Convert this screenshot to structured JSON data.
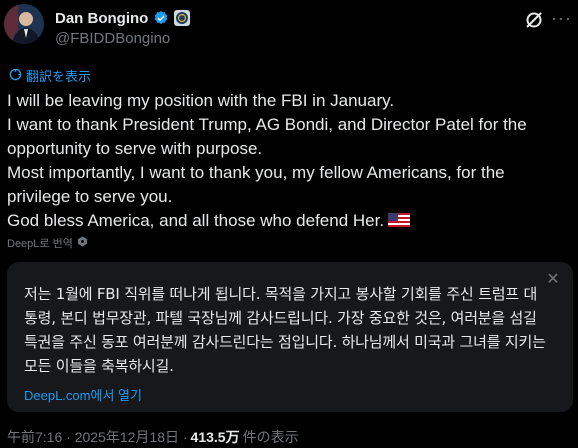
{
  "author": {
    "display_name": "Dan Bongino",
    "handle": "@FBIDDBongino"
  },
  "translate_link": "翻訳を表示",
  "tweet_lines": [
    "I will be leaving my position with the FBI in January.",
    "I want to thank President Trump, AG Bondi, and Director Patel for the",
    "opportunity to serve with purpose.",
    "Most importantly, I want to thank you, my fellow Americans, for the",
    "privilege to serve you.",
    "God bless America, and all those who defend Her."
  ],
  "deepl_credit": "DeepL로 번역",
  "translation": {
    "text": "저는 1월에 FBI 직위를 떠나게 됩니다. 목적을 가지고 봉사할 기회를 주신 트럼프 대통령, 본디 법무장관, 파텔 국장님께 감사드립니다. 가장 중요한 것은, 여러분을 섬길 특권을 주신 동포 여러분께 감사드린다는 점입니다. 하나님께서 미국과 그녀를 지키는 모든 이들을 축복하시길.",
    "link": "DeepL.com에서 열기"
  },
  "meta": {
    "time": "午前7:16 · 2025年12月18日 · ",
    "views": "413.5万",
    "views_suffix": " 件の表示"
  },
  "colors": {
    "accent": "#1d9bf0",
    "verified": "#1d9bf0",
    "muted": "#71767b"
  }
}
